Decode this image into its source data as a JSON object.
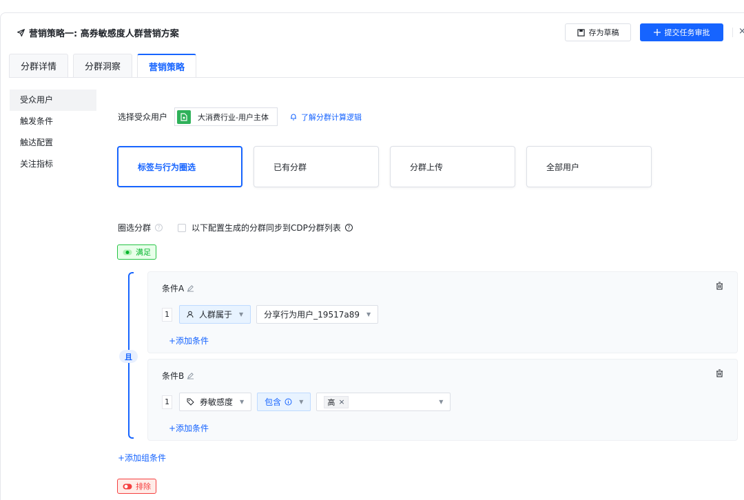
{
  "header": {
    "title": "营销策略一: 高券敏感度人群营销方案",
    "draft_label": "存为草稿",
    "submit_label": "提交任务审批",
    "close_glyph": "×"
  },
  "tabs": [
    {
      "label": "分群详情"
    },
    {
      "label": "分群洞察"
    },
    {
      "label": "营销策略"
    }
  ],
  "sidebar": {
    "items": [
      {
        "label": "受众用户"
      },
      {
        "label": "触发条件"
      },
      {
        "label": "触达配置"
      },
      {
        "label": "关注指标"
      }
    ]
  },
  "audience": {
    "label": "选择受众用户",
    "source": "大消费行业-用户主体",
    "learn_link": "了解分群计算逻辑"
  },
  "cards": [
    {
      "label": "标签与行为圈选"
    },
    {
      "label": "已有分群"
    },
    {
      "label": "分群上传"
    },
    {
      "label": "全部用户"
    }
  ],
  "circle": {
    "label": "圈选分群",
    "sync_label": "以下配置生成的分群同步到CDP分群列表",
    "satisfy_tag": "满足",
    "and_label": "且",
    "exclude_tag": "排除",
    "add_group": "+添加组条件"
  },
  "groups": [
    {
      "title": "条件A",
      "index": "1",
      "field": "人群属于",
      "value": "分享行为用户_19517a89",
      "add_label": "+添加条件"
    },
    {
      "title": "条件B",
      "index": "1",
      "field": "券敏感度",
      "operator": "包含",
      "value_chip": "高",
      "add_label": "+添加条件"
    }
  ],
  "colors": {
    "primary": "#1664ff",
    "success": "#00b42a",
    "danger": "#f53f3f"
  }
}
